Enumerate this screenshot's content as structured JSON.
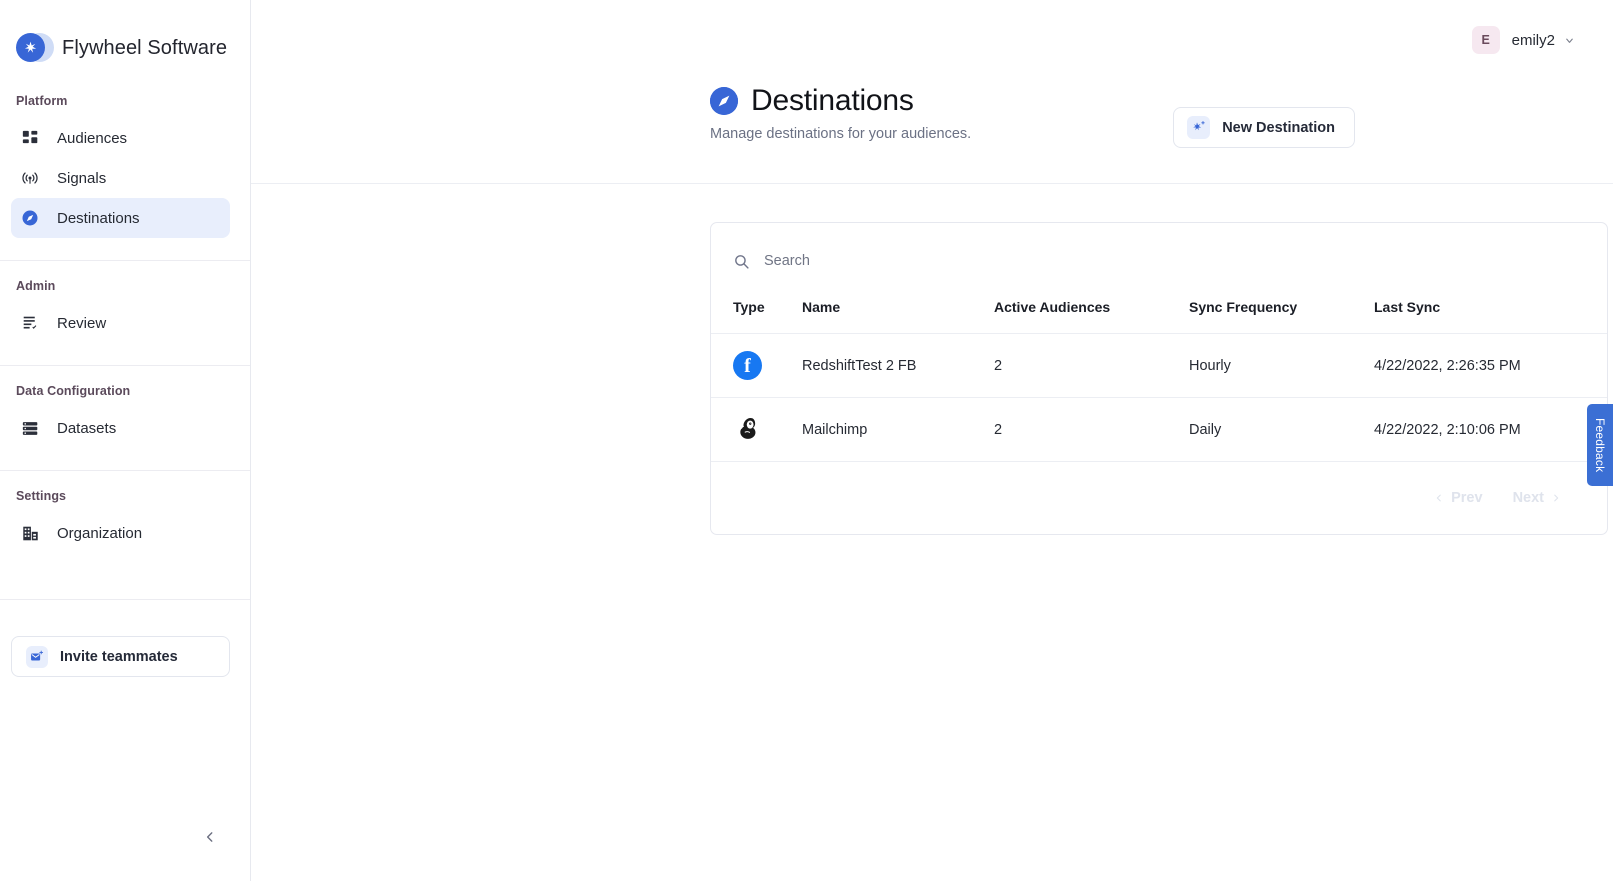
{
  "brand": {
    "name": "Flywheel Software",
    "logo_color": "#3866d6"
  },
  "sidebar": {
    "sections": [
      {
        "label": "Platform",
        "items": [
          {
            "label": "Audiences",
            "icon": "grid-icon",
            "active": false
          },
          {
            "label": "Signals",
            "icon": "broadcast-icon",
            "active": false
          },
          {
            "label": "Destinations",
            "icon": "compass-icon",
            "active": true
          }
        ]
      },
      {
        "label": "Admin",
        "items": [
          {
            "label": "Review",
            "icon": "checklist-icon",
            "active": false
          }
        ]
      },
      {
        "label": "Data Configuration",
        "items": [
          {
            "label": "Datasets",
            "icon": "database-list-icon",
            "active": false
          }
        ]
      },
      {
        "label": "Settings",
        "items": [
          {
            "label": "Organization",
            "icon": "building-icon",
            "active": false
          }
        ]
      }
    ],
    "invite_label": "Invite teammates",
    "invite_icon": "envelope-plus-icon",
    "collapse_icon": "chevron-left-icon"
  },
  "topbar": {
    "user_initial": "E",
    "user_name": "emily2",
    "caret_icon": "chevron-down-icon"
  },
  "page": {
    "title": "Destinations",
    "title_icon": "compass-icon",
    "subtitle": "Manage destinations for your audiences.",
    "new_button_label": "New Destination",
    "new_button_icon": "sparkle-plus-icon"
  },
  "search": {
    "placeholder": "Search",
    "value": "",
    "icon": "search-icon"
  },
  "table": {
    "columns": [
      "Type",
      "Name",
      "Active Audiences",
      "Sync Frequency",
      "Last Sync"
    ],
    "rows": [
      {
        "type_icon": "facebook-icon",
        "name": "RedshiftTest 2 FB",
        "active_audiences": "2",
        "sync_frequency": "Hourly",
        "last_sync": "4/22/2022, 2:26:35 PM"
      },
      {
        "type_icon": "mailchimp-icon",
        "name": "Mailchimp",
        "active_audiences": "2",
        "sync_frequency": "Daily",
        "last_sync": "4/22/2022, 2:10:06 PM"
      }
    ]
  },
  "pagination": {
    "prev_label": "Prev",
    "next_label": "Next"
  },
  "feedback": {
    "label": "Feedback",
    "color": "#3b6fd4"
  }
}
